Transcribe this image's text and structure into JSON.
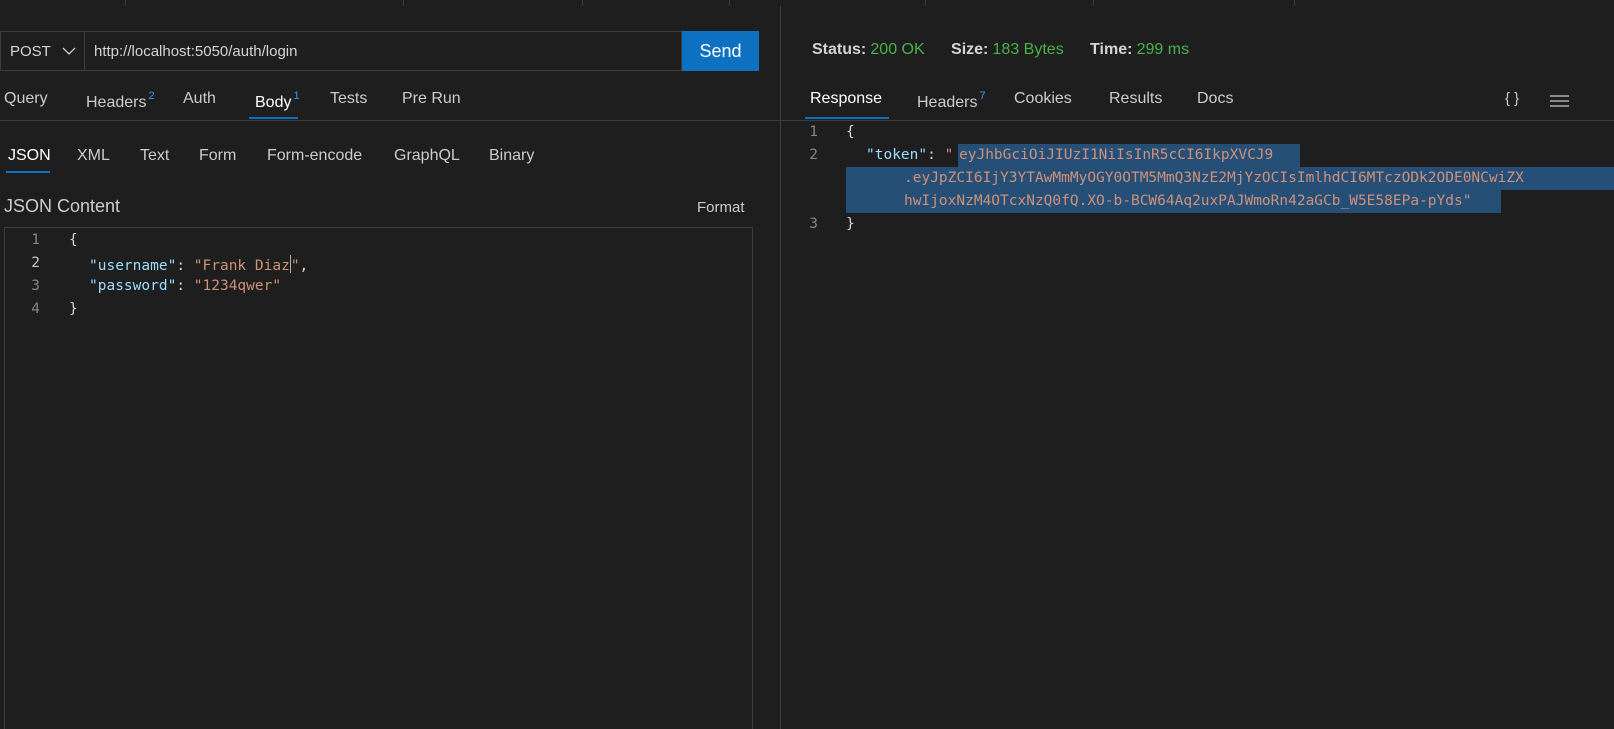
{
  "request": {
    "method": "POST",
    "url": "http://localhost:5050/auth/login",
    "send_label": "Send",
    "tabs": [
      {
        "label": "Query",
        "badge": ""
      },
      {
        "label": "Headers",
        "badge": "2"
      },
      {
        "label": "Auth",
        "badge": ""
      },
      {
        "label": "Body",
        "badge": "1"
      },
      {
        "label": "Tests",
        "badge": ""
      },
      {
        "label": "Pre Run",
        "badge": ""
      }
    ],
    "active_tab": "Body",
    "body_types": [
      "JSON",
      "XML",
      "Text",
      "Form",
      "Form-encode",
      "GraphQL",
      "Binary"
    ],
    "active_body_type": "JSON",
    "content_label": "JSON Content",
    "format_label": "Format",
    "editor": {
      "line_numbers": [
        "1",
        "2",
        "3",
        "4"
      ],
      "open_brace": "{",
      "close_brace": "}",
      "username_key": "\"username\"",
      "username_value_before_cursor": "\"Frank Diaz",
      "username_value_after_cursor": "\"",
      "password_key": "\"password\"",
      "password_value": "\"1234qwer\""
    }
  },
  "response": {
    "status_label": "Status:",
    "status_value": "200 OK",
    "size_label": "Size:",
    "size_value": "183 Bytes",
    "time_label": "Time:",
    "time_value": "299 ms",
    "tabs": [
      {
        "label": "Response",
        "badge": ""
      },
      {
        "label": "Headers",
        "badge": "7"
      },
      {
        "label": "Cookies",
        "badge": ""
      },
      {
        "label": "Results",
        "badge": ""
      },
      {
        "label": "Docs",
        "badge": ""
      }
    ],
    "active_tab": "Response",
    "braces_icon_text": "{ }",
    "editor": {
      "line_numbers": [
        "1",
        "2",
        "3"
      ],
      "open_brace": "{",
      "close_brace": "}",
      "token_key": "\"token\"",
      "token_lines": [
        "eyJhbGciOiJIUzI1NiIsInR5cCI6IkpXVCJ9",
        ".eyJpZCI6IjY3YTAwMmMyOGY0OTM5MmQ3NzE2MjYzOCIsImlhdCI6MTczODk2ODE0NCwiZX",
        "hwIjoxNzM4OTcxNzQ0fQ.XO-b-BCW64Aq2uxPAJWmoRn42aGCb_W5E58EPa-pYds"
      ]
    }
  },
  "colors": {
    "accent": "#0e70c0",
    "status_ok": "#48b14a",
    "json_key": "#9cdcfe",
    "json_string": "#ce9178",
    "selection": "#264f78"
  }
}
